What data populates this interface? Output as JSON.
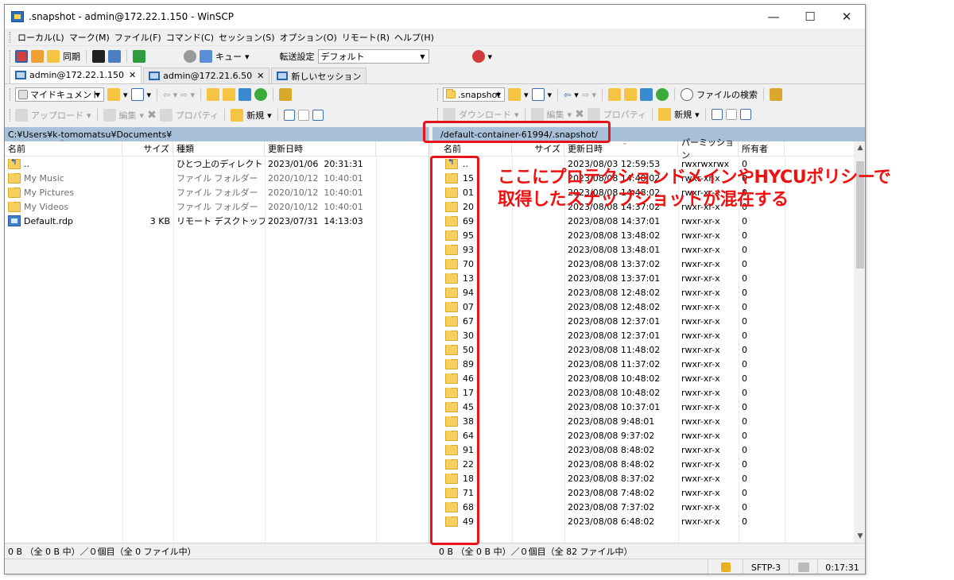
{
  "window": {
    "title": ".snapshot - admin@172.22.1.150 - WinSCP",
    "minimize": "—",
    "maximize": "☐",
    "close": "✕"
  },
  "menu": [
    "ローカル(L)",
    "マーク(M)",
    "ファイル(F)",
    "コマンド(C)",
    "セッション(S)",
    "オプション(O)",
    "リモート(R)",
    "ヘルプ(H)"
  ],
  "toolbar": {
    "sync_label": "同期",
    "queue_label": "キュー",
    "transfer_label": "転送設定",
    "transfer_value": "デフォルト"
  },
  "tabs": [
    {
      "label": "admin@172.22.1.150",
      "close": "✕"
    },
    {
      "label": "admin@172.21.6.50",
      "close": "✕"
    },
    {
      "label": "新しいセッション"
    }
  ],
  "left": {
    "location": "マイドキュメント",
    "upload_label": "アップロード",
    "edit_label": "編集",
    "props_label": "プロパティ",
    "new_label": "新規",
    "path": "C:¥Users¥k-tomomatsu¥Documents¥",
    "columns": [
      "名前",
      "サイズ",
      "種類",
      "更新日時"
    ],
    "rows": [
      {
        "name": "..",
        "size": "",
        "type": "ひとつ上のディレクトリ",
        "date": "2023/01/06  20:31:31",
        "icon": "up-folder"
      },
      {
        "name": "My Music",
        "size": "",
        "type": "ファイル フォルダー",
        "date": "2020/10/12  10:40:01",
        "icon": "folder"
      },
      {
        "name": "My Pictures",
        "size": "",
        "type": "ファイル フォルダー",
        "date": "2020/10/12  10:40:01",
        "icon": "folder"
      },
      {
        "name": "My Videos",
        "size": "",
        "type": "ファイル フォルダー",
        "date": "2020/10/12  10:40:01",
        "icon": "folder"
      },
      {
        "name": "Default.rdp",
        "size": "3 KB",
        "type": "リモート デスクトップ...",
        "date": "2023/07/31  14:13:03",
        "icon": "rdp"
      }
    ],
    "status": "0 B （全 0 B 中）／０個目（全 0 ファイル中）"
  },
  "right": {
    "location": ".snapshot",
    "find_label": "ファイルの検索",
    "download_label": "ダウンロード",
    "edit_label": "編集",
    "props_label": "プロパティ",
    "new_label": "新規",
    "path": "/default-container-61994/.snapshot/",
    "columns": [
      "名前",
      "サイズ",
      "更新日時",
      "パーミッション",
      "所有者"
    ],
    "rows": [
      {
        "name": "..",
        "date": "2023/08/03 12:59:53",
        "perm": "rwxrwxrwx",
        "owner": "0",
        "icon": "up-folder"
      },
      {
        "name": "15",
        "date": "2023/08/08 14:48:02",
        "perm": "rwxr-xr-x",
        "owner": "0"
      },
      {
        "name": "01",
        "date": "2023/08/08 14:48:02",
        "perm": "rwxr-xr-x",
        "owner": "0"
      },
      {
        "name": "20",
        "date": "2023/08/08 14:37:02",
        "perm": "rwxr-xr-x",
        "owner": "0"
      },
      {
        "name": "69",
        "date": "2023/08/08 14:37:01",
        "perm": "rwxr-xr-x",
        "owner": "0"
      },
      {
        "name": "95",
        "date": "2023/08/08 13:48:02",
        "perm": "rwxr-xr-x",
        "owner": "0"
      },
      {
        "name": "93",
        "date": "2023/08/08 13:48:01",
        "perm": "rwxr-xr-x",
        "owner": "0"
      },
      {
        "name": "70",
        "date": "2023/08/08 13:37:02",
        "perm": "rwxr-xr-x",
        "owner": "0"
      },
      {
        "name": "13",
        "date": "2023/08/08 13:37:01",
        "perm": "rwxr-xr-x",
        "owner": "0"
      },
      {
        "name": "94",
        "date": "2023/08/08 12:48:02",
        "perm": "rwxr-xr-x",
        "owner": "0"
      },
      {
        "name": "07",
        "date": "2023/08/08 12:48:02",
        "perm": "rwxr-xr-x",
        "owner": "0"
      },
      {
        "name": "67",
        "date": "2023/08/08 12:37:01",
        "perm": "rwxr-xr-x",
        "owner": "0"
      },
      {
        "name": "30",
        "date": "2023/08/08 12:37:01",
        "perm": "rwxr-xr-x",
        "owner": "0"
      },
      {
        "name": "50",
        "date": "2023/08/08 11:48:02",
        "perm": "rwxr-xr-x",
        "owner": "0"
      },
      {
        "name": "89",
        "date": "2023/08/08 11:37:02",
        "perm": "rwxr-xr-x",
        "owner": "0"
      },
      {
        "name": "46",
        "date": "2023/08/08 10:48:02",
        "perm": "rwxr-xr-x",
        "owner": "0"
      },
      {
        "name": "17",
        "date": "2023/08/08 10:48:02",
        "perm": "rwxr-xr-x",
        "owner": "0"
      },
      {
        "name": "45",
        "date": "2023/08/08 10:37:01",
        "perm": "rwxr-xr-x",
        "owner": "0"
      },
      {
        "name": "38",
        "date": "2023/08/08 9:48:01",
        "perm": "rwxr-xr-x",
        "owner": "0"
      },
      {
        "name": "64",
        "date": "2023/08/08 9:37:02",
        "perm": "rwxr-xr-x",
        "owner": "0"
      },
      {
        "name": "91",
        "date": "2023/08/08 8:48:02",
        "perm": "rwxr-xr-x",
        "owner": "0"
      },
      {
        "name": "22",
        "date": "2023/08/08 8:48:02",
        "perm": "rwxr-xr-x",
        "owner": "0"
      },
      {
        "name": "18",
        "date": "2023/08/08 8:37:02",
        "perm": "rwxr-xr-x",
        "owner": "0"
      },
      {
        "name": "71",
        "date": "2023/08/08 7:48:02",
        "perm": "rwxr-xr-x",
        "owner": "0"
      },
      {
        "name": "68",
        "date": "2023/08/08 7:37:02",
        "perm": "rwxr-xr-x",
        "owner": "0"
      },
      {
        "name": "49",
        "date": "2023/08/08 6:48:02",
        "perm": "rwxr-xr-x",
        "owner": "0"
      }
    ],
    "status": "0 B （全 0 B 中）／０個目（全 82 ファイル中）"
  },
  "bottom": {
    "protocol": "SFTP-3",
    "elapsed": "0:17:31"
  },
  "annotation": {
    "line1": "ここにプロテクションドメインやHYCUポリシーで",
    "line2": "取得したスナップショットが混在する"
  },
  "colors": {
    "annotation": "#f01010",
    "pathbar": "#a8c0d8"
  }
}
